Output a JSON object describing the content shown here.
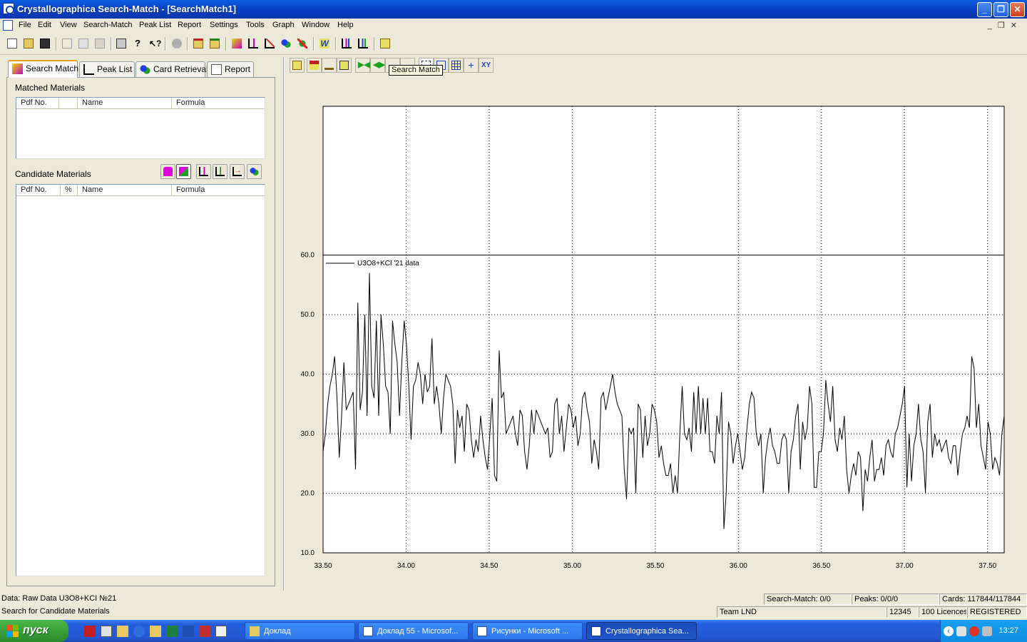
{
  "window": {
    "title": "Crystallographica Search-Match - [SearchMatch1]",
    "minimize": "_",
    "restore": "❐",
    "close": "✕"
  },
  "menu": [
    "File",
    "Edit",
    "View",
    "Search-Match",
    "Peak List",
    "Report",
    "Settings",
    "Tools",
    "Graph",
    "Window",
    "Help"
  ],
  "tabs": [
    {
      "label": "Search Match",
      "icon": "search-match-icon"
    },
    {
      "label": "Peak List",
      "icon": "peak-list-icon"
    },
    {
      "label": "Card Retrieval",
      "icon": "card-retrieval-icon"
    },
    {
      "label": "Report",
      "icon": "report-icon"
    }
  ],
  "matched": {
    "label": "Matched Materials",
    "columns": [
      "Pdf No.",
      "",
      "Name",
      "Formula"
    ]
  },
  "candidate": {
    "label": "Candidate Materials",
    "columns": [
      "Pdf No.",
      "%",
      "Name",
      "Formula"
    ]
  },
  "graph_toolbar": {
    "xy_label": "XY",
    "tooltip": "Search Match"
  },
  "chart_data": {
    "type": "line",
    "series": [
      {
        "name": "U3O8+KCI '21 data",
        "x_start": 33.5,
        "x_end": 37.6,
        "values": [
          27,
          30,
          35,
          38,
          40,
          43,
          36,
          26,
          33,
          42,
          34,
          35,
          36,
          37,
          24,
          52,
          34,
          37,
          50,
          33,
          57,
          38,
          36,
          49,
          33,
          50,
          45,
          38,
          37,
          30,
          49,
          45,
          42,
          33,
          42,
          49,
          45,
          38,
          29,
          38,
          39,
          42,
          40,
          35,
          40,
          37,
          38,
          46,
          35,
          38,
          35,
          30,
          36,
          40,
          39,
          38,
          35,
          25,
          34,
          31,
          33,
          27,
          35,
          34,
          29,
          26,
          29,
          27,
          33,
          29,
          26,
          24,
          30,
          36,
          23,
          22,
          44,
          36,
          37,
          30,
          31,
          32,
          33,
          30,
          28,
          34,
          33,
          27,
          24,
          28,
          34,
          30,
          34,
          33,
          32,
          31,
          30,
          31,
          26,
          27,
          35,
          36,
          30,
          33,
          27,
          31,
          35,
          34,
          31,
          33,
          28,
          30,
          36,
          37,
          34,
          32,
          25,
          29,
          27,
          24,
          36,
          37,
          34,
          36,
          38,
          40,
          37,
          35,
          34,
          33,
          24,
          19,
          31,
          30,
          31,
          20,
          35,
          34,
          26,
          33,
          28,
          30,
          35,
          34,
          32,
          26,
          28,
          25,
          23,
          23,
          25,
          20,
          23,
          20,
          30,
          38,
          30,
          29,
          31,
          27,
          37,
          30,
          38,
          30,
          36,
          30,
          36,
          27,
          27,
          25,
          33,
          30,
          37,
          14,
          20,
          32,
          30,
          25,
          28,
          30,
          27,
          24,
          26,
          31,
          35,
          37,
          36,
          30,
          28,
          30,
          20,
          26,
          29,
          31,
          28,
          27,
          25,
          25,
          29,
          30,
          29,
          20,
          27,
          29,
          33,
          35,
          24,
          32,
          29,
          31,
          38,
          35,
          21,
          21,
          27,
          27,
          30,
          39,
          35,
          32,
          38,
          29,
          27,
          31,
          29,
          33,
          24,
          20,
          23,
          25,
          23,
          27,
          26,
          17,
          24,
          22,
          26,
          29,
          22,
          24,
          24,
          26,
          23,
          28,
          29,
          27,
          26,
          30,
          31,
          33,
          35,
          38,
          21,
          30,
          22,
          28,
          30,
          35,
          29,
          27,
          20,
          32,
          35,
          26,
          30,
          28,
          29,
          27,
          28,
          29,
          26,
          25,
          28,
          28,
          23,
          27,
          30,
          31,
          33,
          31,
          43,
          41,
          31,
          35,
          28,
          26,
          24,
          32,
          30,
          24,
          26,
          25,
          23,
          30,
          33
        ],
        "color": "#000000"
      }
    ],
    "xlim": [
      33.5,
      37.6
    ],
    "ylim": [
      10,
      85
    ],
    "x_ticks": [
      "33.50",
      "34.00",
      "34.50",
      "35.00",
      "35.50",
      "36.00",
      "36.50",
      "37.00",
      "37.50"
    ],
    "y_ticks": [
      "10.0",
      "20.0",
      "30.0",
      "40.0",
      "50.0",
      "60.0"
    ],
    "hline": 60,
    "grid": true,
    "legend": "top-left"
  },
  "status": {
    "data_text": "Data: Raw Data U3O8+KCI №21",
    "search_match": "Search-Match: 0/0",
    "peaks": "Peaks: 0/0/0",
    "cards": "Cards: 117844/117844",
    "hint": "Search for Candidate Materials",
    "team": "Team LND",
    "serial": "12345",
    "licences": "100 Licences",
    "registered": "REGISTERED"
  },
  "taskbar": {
    "start": "пуск",
    "tasks": [
      {
        "label": "Доклад",
        "icon": "folder-icon"
      },
      {
        "label": "Доклад 55 - Microsof...",
        "icon": "word-icon"
      },
      {
        "label": "Рисунки - Microsoft ...",
        "icon": "word-icon"
      },
      {
        "label": "Crystallographica Sea...",
        "icon": "crystallographica-icon"
      }
    ],
    "clock": "13:27"
  }
}
